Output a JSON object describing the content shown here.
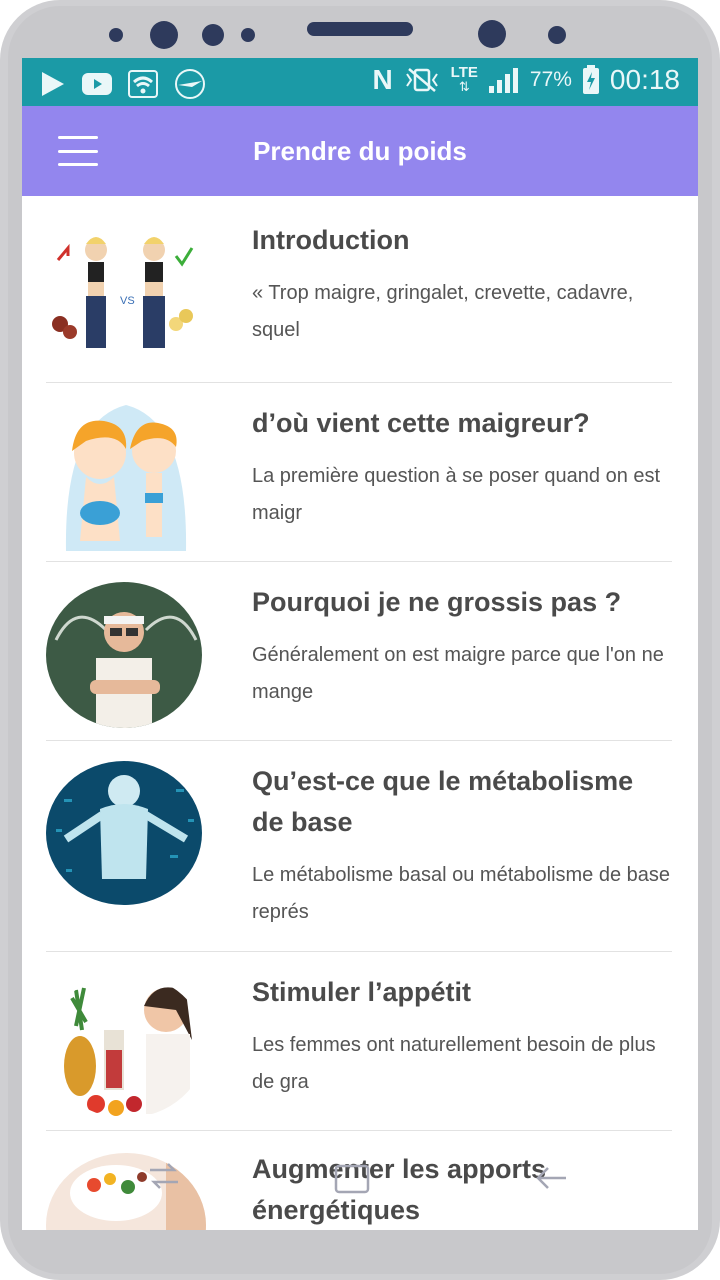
{
  "status_bar": {
    "battery": "77%",
    "time": "00:18",
    "network": "LTE",
    "icons": [
      "play-store-icon",
      "youtube-icon",
      "wifi-icon",
      "airplane-logo-icon",
      "nfc-icon",
      "vibrate-icon",
      "lte-icon",
      "signal-icon",
      "battery-charging-icon"
    ]
  },
  "app_bar": {
    "title": "Prendre du poids",
    "menu_icon": "hamburger-menu-icon"
  },
  "articles": [
    {
      "title": "Introduction",
      "description": "« Trop maigre, gringalet, crevette, cadavre, squel"
    },
    {
      "title": "d’où vient cette maigreur?",
      "description": "La première question à se poser quand on est maigr"
    },
    {
      "title": "Pourquoi je ne grossis pas ?",
      "description": "Généralement on est maigre parce que l'on ne mange"
    },
    {
      "title": "Qu’est-ce que le métabolisme de base",
      "description": "Le métabolisme basal ou métabolisme de base représ"
    },
    {
      "title": "Stimuler l’appétit",
      "description": "Les femmes ont naturellement besoin de plus de gra"
    },
    {
      "title": "Augmenter les apports énergétiques",
      "description": ""
    }
  ],
  "nav_bar": {
    "icons": [
      "recent-apps-icon",
      "home-icon",
      "back-icon"
    ]
  },
  "colors": {
    "status_bar": "#1b9aa6",
    "app_bar": "#9386ee",
    "title_text": "#4a4a4a"
  }
}
